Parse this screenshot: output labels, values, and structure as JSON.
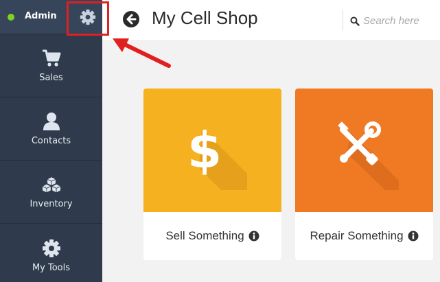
{
  "sidebar": {
    "user_name": "Admin",
    "status_color": "#7ed321",
    "settings_icon": "gear-icon",
    "items": [
      {
        "label": "Sales",
        "icon": "cart-icon"
      },
      {
        "label": "Contacts",
        "icon": "user-icon"
      },
      {
        "label": "Inventory",
        "icon": "boxes-icon"
      },
      {
        "label": "My Tools",
        "icon": "gear-icon"
      }
    ]
  },
  "header": {
    "back_icon": "back-arrow-icon",
    "title": "My Cell Shop",
    "search_placeholder": "Search here"
  },
  "cards": [
    {
      "label": "Sell Something",
      "icon": "dollar-icon",
      "color": "#f5b120"
    },
    {
      "label": "Repair Something",
      "icon": "tools-icon",
      "color": "#f07a24"
    }
  ],
  "colors": {
    "sidebar_bg": "#2f3b4c",
    "highlight_red": "#e02020"
  }
}
